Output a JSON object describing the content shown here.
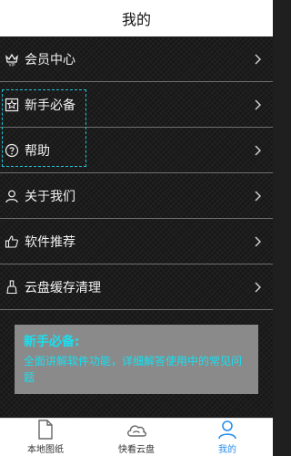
{
  "header": {
    "title": "我的"
  },
  "menu": {
    "items": [
      {
        "label": "会员中心",
        "icon": "vip-crown-icon"
      },
      {
        "label": "新手必备",
        "icon": "star-box-icon"
      },
      {
        "label": "帮助",
        "icon": "question-circle-icon"
      },
      {
        "label": "关于我们",
        "icon": "user-icon"
      },
      {
        "label": "软件推荐",
        "icon": "thumbs-up-icon"
      },
      {
        "label": "云盘缓存清理",
        "icon": "broom-icon"
      }
    ]
  },
  "tooltip": {
    "title": "新手必备:",
    "body": "全面讲解软件功能，详细解答使用中的常见问题"
  },
  "tabbar": {
    "tabs": [
      {
        "label": "本地图纸",
        "icon": "document-icon",
        "active": false
      },
      {
        "label": "快看云盘",
        "icon": "cloud-icon",
        "active": false
      },
      {
        "label": "我的",
        "icon": "person-icon",
        "active": true
      }
    ]
  },
  "colors": {
    "accent": "#2a8ee8",
    "highlight": "#20c4d6",
    "tooltip_text": "#18e0f0"
  }
}
